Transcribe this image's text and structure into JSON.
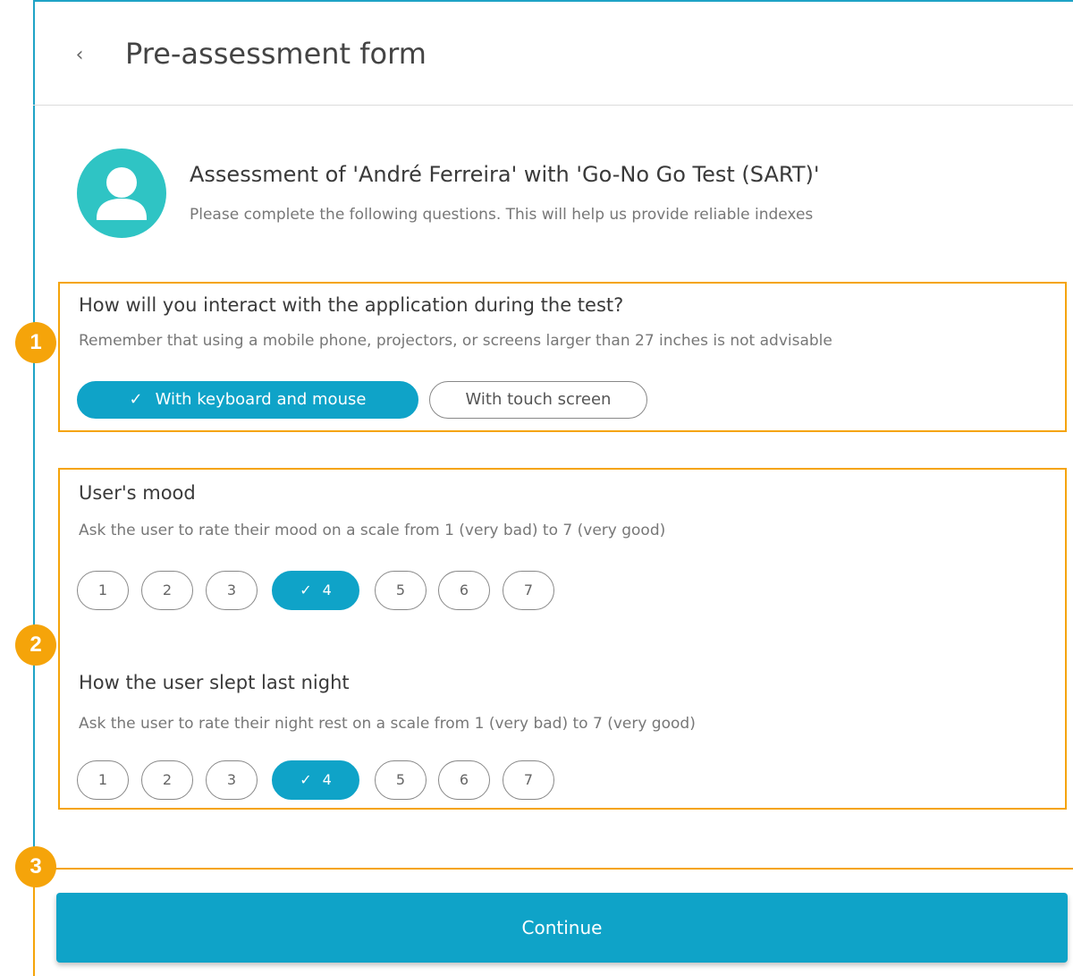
{
  "header": {
    "back_icon": "chevron-left-icon",
    "back_glyph": "‹",
    "title": "Pre-assessment form"
  },
  "info": {
    "avatar_icon": "user-avatar-icon",
    "title": "Assessment of 'André Ferreira' with 'Go-No Go Test (SART)'",
    "subtitle": "Please complete the following questions. This will help us provide reliable indexes"
  },
  "badges": [
    "1",
    "2",
    "3"
  ],
  "interaction": {
    "title": "How will you interact with the application during the test?",
    "subtitle": "Remember that using a mobile phone, projectors, or screens larger than 27 inches is not advisable",
    "options": [
      {
        "label": "With keyboard and mouse",
        "selected": true
      },
      {
        "label": "With touch screen",
        "selected": false
      }
    ]
  },
  "mood": {
    "title": "User's mood",
    "subtitle": "Ask the user to rate their mood on a scale from 1 (very bad) to 7 (very good)",
    "options": [
      "1",
      "2",
      "3",
      "4",
      "5",
      "6",
      "7"
    ],
    "selected": "4"
  },
  "sleep": {
    "title": "How the user slept last night",
    "subtitle": "Ask the user to rate their night rest on a scale from 1 (very bad) to 7 (very good)",
    "options": [
      "1",
      "2",
      "3",
      "4",
      "5",
      "6",
      "7"
    ],
    "selected": "4"
  },
  "check_glyph": "✓",
  "footer": {
    "continue_label": "Continue"
  },
  "colors": {
    "accent": "#0fa3c8",
    "highlight": "#f5a40a",
    "avatar": "#2fc4c4"
  }
}
